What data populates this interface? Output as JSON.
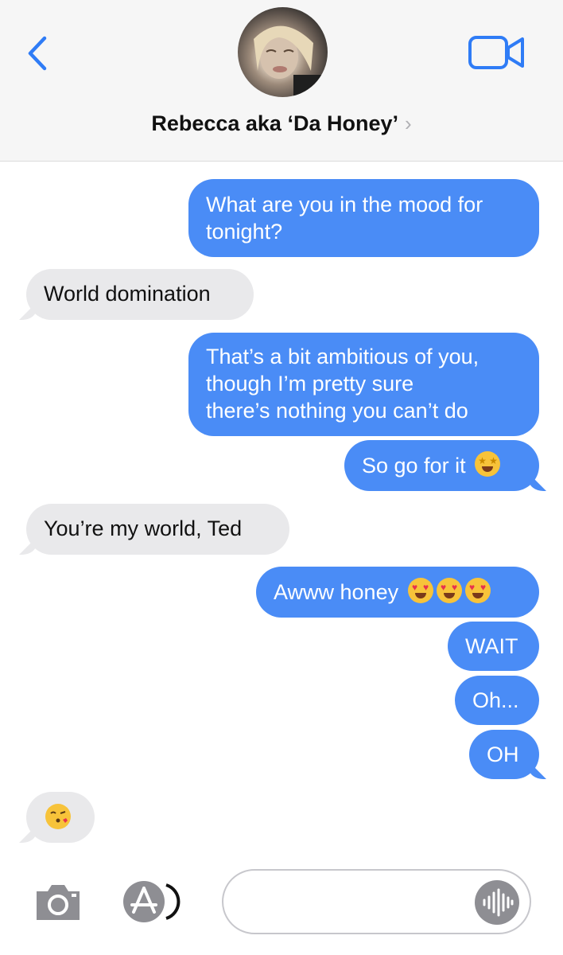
{
  "header": {
    "contact_name": "Rebecca aka ‘Da Honey’",
    "back_icon": "chevron-left-icon",
    "video_icon": "video-camera-icon",
    "accent": "#2f7cf6"
  },
  "messages": [
    {
      "from": "me",
      "text_lines": [
        "What are you in the mood for",
        "tonight?"
      ]
    },
    {
      "from": "them",
      "text": "World domination"
    },
    {
      "from": "me",
      "text_lines": [
        "That’s a bit ambitious of you,",
        "though I’m pretty sure",
        "there’s nothing you can’t do"
      ]
    },
    {
      "from": "me",
      "text": "So go for it",
      "emoji": "star-struck-emoji"
    },
    {
      "from": "them",
      "text": "You’re my world, Ted"
    },
    {
      "from": "me",
      "text": "Awww honey",
      "emoji": "heart-eyes-emoji",
      "emoji_count": 3
    },
    {
      "from": "me",
      "text": "WAIT"
    },
    {
      "from": "me",
      "text": "Oh..."
    },
    {
      "from": "me",
      "text": "OH"
    },
    {
      "from": "them",
      "emoji": "kissing-face-emoji"
    }
  ],
  "colors": {
    "outgoing": "#4a8cf6",
    "incoming": "#e9e9eb"
  },
  "toolbar": {
    "camera_icon": "camera-icon",
    "appstore_icon": "app-store-icon",
    "input_placeholder": "",
    "audio_icon": "audio-waveform-icon"
  }
}
